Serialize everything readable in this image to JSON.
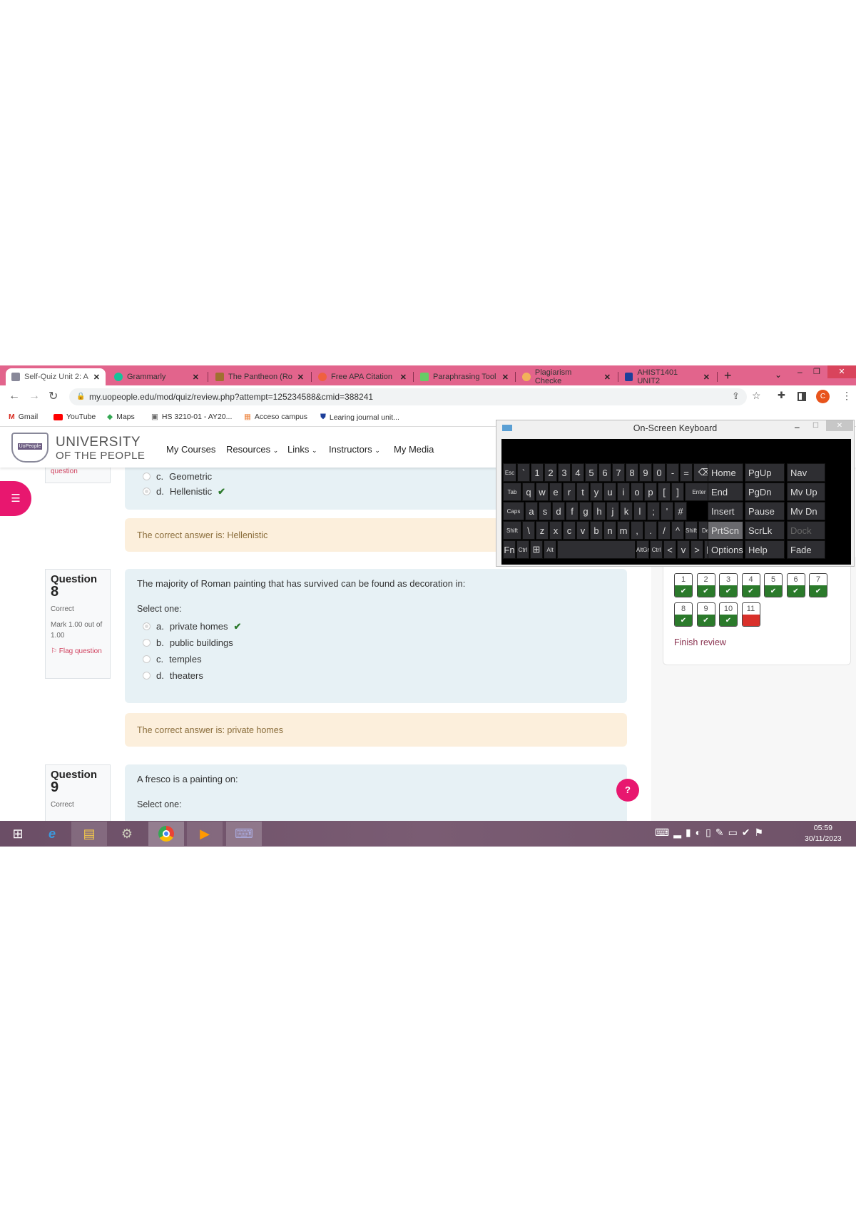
{
  "browser": {
    "tabs": [
      {
        "title": "Self-Quiz Unit 2: A",
        "active": true,
        "icon": "uopeople-icon"
      },
      {
        "title": "Grammarly",
        "icon": "grammarly-icon"
      },
      {
        "title": "The Pantheon (Ro",
        "icon": "pantheon-icon"
      },
      {
        "title": "Free APA Citation",
        "icon": "citation-icon"
      },
      {
        "title": "Paraphrasing Tool",
        "icon": "paraphrase-icon"
      },
      {
        "title": "Plagiarism Checke",
        "icon": "magnifier-icon"
      },
      {
        "title": "AHIST1401 UNIT2",
        "icon": "shield-icon"
      }
    ],
    "new_tab": "+",
    "url": "my.uopeople.edu/mod/quiz/review.php?attempt=125234588&cmid=388241",
    "profile_initial": "C",
    "bookmarks": [
      "Gmail",
      "YouTube",
      "Maps",
      "HS 3210-01 - AY20...",
      "Acceso campus",
      "Learing journal unit..."
    ],
    "accent": "#e2648c"
  },
  "site": {
    "logo_line1": "UNIVERSITY",
    "logo_line2": "OF THE PEOPLE",
    "logo_badge": "UoPeople",
    "nav": [
      "My Courses",
      "Resources",
      "Links",
      "Instructors",
      "My Media"
    ]
  },
  "quiz": {
    "prev": {
      "flag_tail": "question",
      "options": [
        {
          "letter": "c.",
          "text": "Geometric"
        },
        {
          "letter": "d.",
          "text": "Hellenistic",
          "correct": true
        }
      ],
      "feedback": "The correct answer is: Hellenistic"
    },
    "q8": {
      "label": "Question",
      "number": "8",
      "status": "Correct",
      "mark": "Mark 1.00 out of 1.00",
      "flag": "Flag question",
      "text": "The majority of Roman painting that has survived can be found as decoration in:",
      "select": "Select one:",
      "options": [
        {
          "letter": "a.",
          "text": "private homes",
          "selected": true,
          "correct": true
        },
        {
          "letter": "b.",
          "text": "public buildings"
        },
        {
          "letter": "c.",
          "text": "temples"
        },
        {
          "letter": "d.",
          "text": "theaters"
        }
      ],
      "feedback": "The correct answer is: private homes"
    },
    "q9": {
      "label": "Question",
      "number": "9",
      "status": "Correct",
      "text": "A fresco is a painting on:",
      "select": "Select one:"
    },
    "navigation": {
      "buttons": [
        {
          "n": "1",
          "state": "correct"
        },
        {
          "n": "2",
          "state": "correct"
        },
        {
          "n": "3",
          "state": "correct"
        },
        {
          "n": "4",
          "state": "correct"
        },
        {
          "n": "5",
          "state": "correct"
        },
        {
          "n": "6",
          "state": "correct"
        },
        {
          "n": "7",
          "state": "correct"
        },
        {
          "n": "8",
          "state": "correct"
        },
        {
          "n": "9",
          "state": "correct"
        },
        {
          "n": "10",
          "state": "correct"
        },
        {
          "n": "11",
          "state": "incorrect"
        }
      ],
      "finish": "Finish review"
    },
    "help": "?"
  },
  "osk": {
    "title": "On-Screen Keyboard",
    "rows": [
      [
        "Esc",
        "`",
        "1",
        "2",
        "3",
        "4",
        "5",
        "6",
        "7",
        "8",
        "9",
        "0",
        "-",
        "=",
        "⌫"
      ],
      [
        "Tab",
        "q",
        "w",
        "e",
        "r",
        "t",
        "y",
        "u",
        "i",
        "o",
        "p",
        "[",
        "]",
        "Enter"
      ],
      [
        "Caps",
        "a",
        "s",
        "d",
        "f",
        "g",
        "h",
        "j",
        "k",
        "l",
        ";",
        "'",
        "#"
      ],
      [
        "Shift",
        "\\",
        "z",
        "x",
        "c",
        "v",
        "b",
        "n",
        "m",
        ",",
        ".",
        "/",
        "^",
        "Shift",
        "Del"
      ],
      [
        "Fn",
        "Ctrl",
        "⊞",
        "Alt",
        "",
        "AltGr",
        "Ctrl",
        "<",
        "v",
        ">",
        "▤"
      ]
    ],
    "side": [
      [
        "Home",
        "PgUp",
        "Nav"
      ],
      [
        "End",
        "PgDn",
        "Mv Up"
      ],
      [
        "Insert",
        "Pause",
        "Mv Dn"
      ],
      [
        "PrtScn",
        "ScrLk",
        "Dock"
      ],
      [
        "Options",
        "Help",
        "Fade"
      ]
    ]
  },
  "taskbar": {
    "time": "05:59",
    "date": "30/11/2023",
    "apps": [
      "start",
      "internet-explorer",
      "file-explorer",
      "control-panel",
      "chrome",
      "media-player",
      "on-screen-keyboard"
    ]
  }
}
